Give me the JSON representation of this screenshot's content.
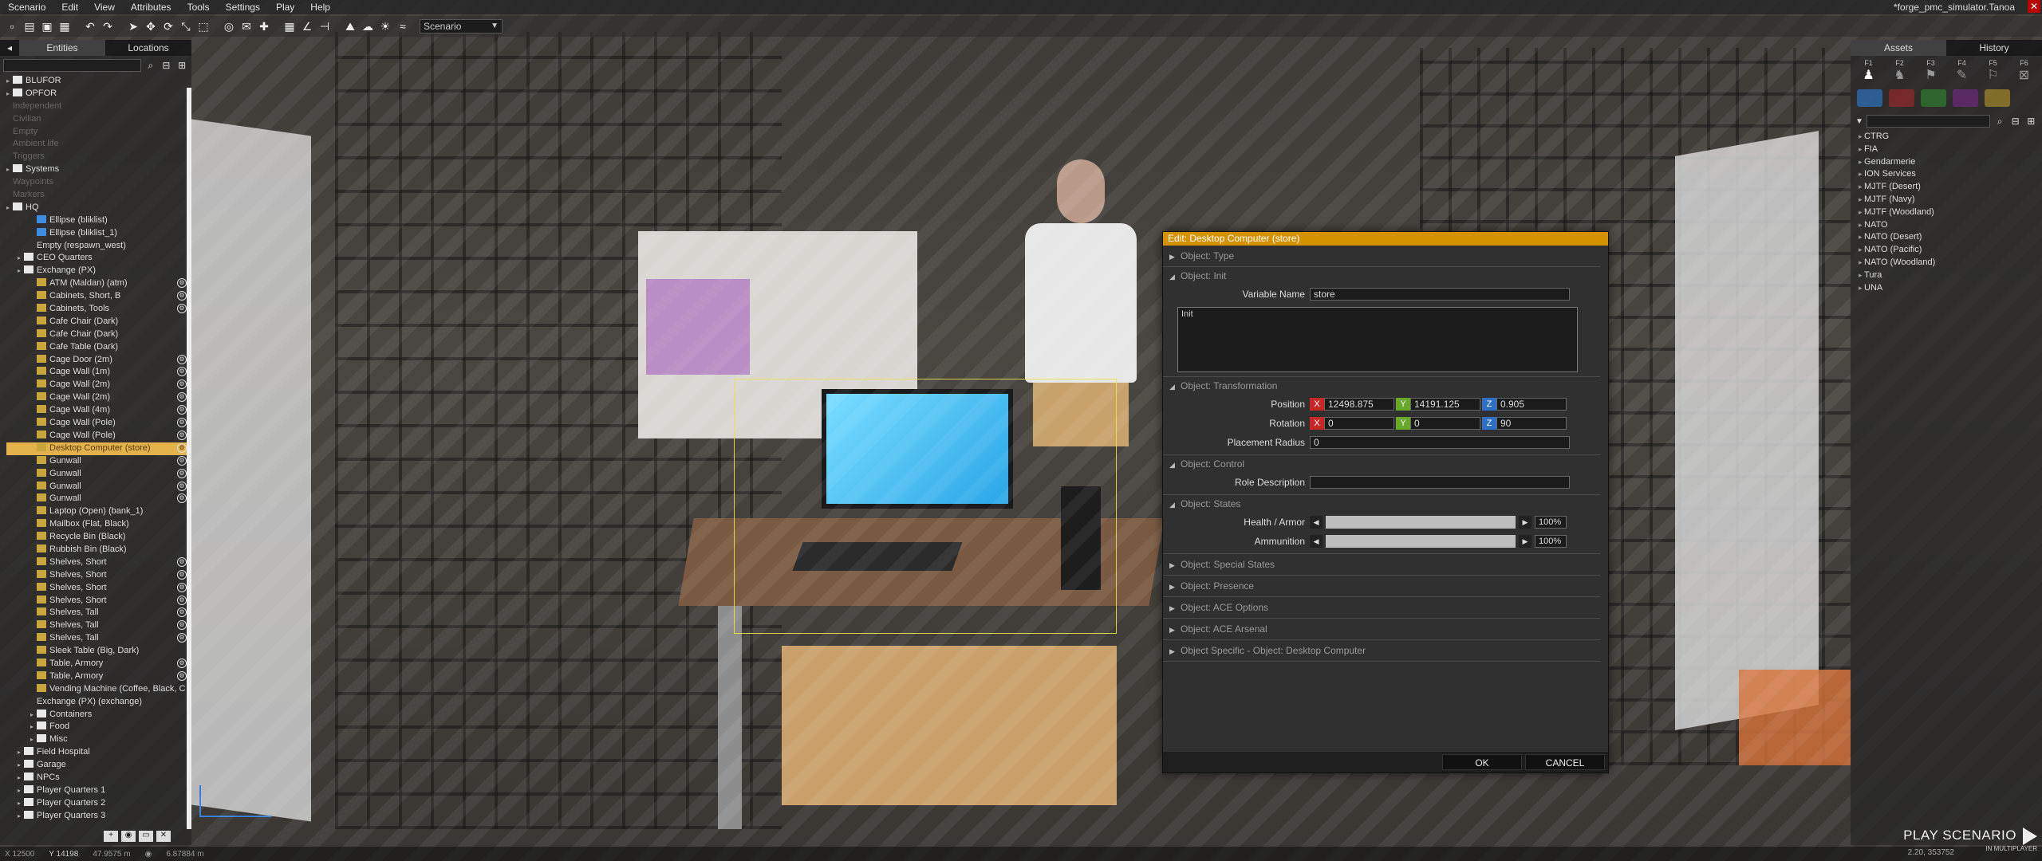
{
  "menu": {
    "items": [
      "Scenario",
      "Edit",
      "View",
      "Attributes",
      "Tools",
      "Settings",
      "Play",
      "Help"
    ],
    "window_title": "*forge_pmc_simulator.Tanoa"
  },
  "toolbar": {
    "mode": "Scenario"
  },
  "left_panel": {
    "tabs": [
      "Entities",
      "Locations"
    ],
    "tree": [
      {
        "label": "BLUFOR",
        "indent": 0,
        "icon": "checkbox",
        "state": "normal"
      },
      {
        "label": "OPFOR",
        "indent": 0,
        "icon": "checkbox",
        "state": "normal"
      },
      {
        "label": "Independent",
        "indent": 0,
        "icon": "none",
        "state": "dim"
      },
      {
        "label": "Civilian",
        "indent": 0,
        "icon": "none",
        "state": "dim"
      },
      {
        "label": "Empty",
        "indent": 0,
        "icon": "none",
        "state": "dim"
      },
      {
        "label": "Ambient life",
        "indent": 0,
        "icon": "none",
        "state": "dim"
      },
      {
        "label": "Triggers",
        "indent": 0,
        "icon": "none",
        "state": "dim"
      },
      {
        "label": "Systems",
        "indent": 0,
        "icon": "checkbox",
        "state": "normal"
      },
      {
        "label": "Waypoints",
        "indent": 0,
        "icon": "none",
        "state": "dim"
      },
      {
        "label": "Markers",
        "indent": 0,
        "icon": "none",
        "state": "dim"
      },
      {
        "label": "HQ",
        "indent": 0,
        "icon": "checkbox",
        "state": "normal"
      },
      {
        "label": "Ellipse (bliklist)",
        "indent": 2,
        "icon": "marker",
        "state": "normal"
      },
      {
        "label": "Ellipse (bliklist_1)",
        "indent": 2,
        "icon": "marker",
        "state": "normal"
      },
      {
        "label": "Empty (respawn_west)",
        "indent": 2,
        "icon": "none",
        "state": "normal"
      },
      {
        "label": "CEO Quarters",
        "indent": 1,
        "icon": "folder",
        "state": "normal"
      },
      {
        "label": "Exchange (PX)",
        "indent": 1,
        "icon": "folder",
        "state": "normal"
      },
      {
        "label": "ATM (Maldan) (atm)",
        "indent": 2,
        "icon": "obj",
        "state": "normal",
        "badge": true
      },
      {
        "label": "Cabinets, Short, B",
        "indent": 2,
        "icon": "obj",
        "state": "normal",
        "badge": true
      },
      {
        "label": "Cabinets, Tools",
        "indent": 2,
        "icon": "obj",
        "state": "normal",
        "badge": true
      },
      {
        "label": "Cafe Chair (Dark)",
        "indent": 2,
        "icon": "obj",
        "state": "normal"
      },
      {
        "label": "Cafe Chair (Dark)",
        "indent": 2,
        "icon": "obj",
        "state": "normal"
      },
      {
        "label": "Cafe Table (Dark)",
        "indent": 2,
        "icon": "obj",
        "state": "normal"
      },
      {
        "label": "Cage Door (2m)",
        "indent": 2,
        "icon": "obj",
        "state": "normal",
        "badge": true
      },
      {
        "label": "Cage Wall (1m)",
        "indent": 2,
        "icon": "obj",
        "state": "normal",
        "badge": true
      },
      {
        "label": "Cage Wall (2m)",
        "indent": 2,
        "icon": "obj",
        "state": "normal",
        "badge": true
      },
      {
        "label": "Cage Wall (2m)",
        "indent": 2,
        "icon": "obj",
        "state": "normal",
        "badge": true
      },
      {
        "label": "Cage Wall (4m)",
        "indent": 2,
        "icon": "obj",
        "state": "normal",
        "badge": true
      },
      {
        "label": "Cage Wall (Pole)",
        "indent": 2,
        "icon": "obj",
        "state": "normal",
        "badge": true
      },
      {
        "label": "Cage Wall (Pole)",
        "indent": 2,
        "icon": "obj",
        "state": "normal",
        "badge": true
      },
      {
        "label": "Desktop Computer (store)",
        "indent": 2,
        "icon": "obj",
        "state": "selected",
        "badge": true
      },
      {
        "label": "Gunwall",
        "indent": 2,
        "icon": "obj",
        "state": "normal",
        "badge": true
      },
      {
        "label": "Gunwall",
        "indent": 2,
        "icon": "obj",
        "state": "normal",
        "badge": true
      },
      {
        "label": "Gunwall",
        "indent": 2,
        "icon": "obj",
        "state": "normal",
        "badge": true
      },
      {
        "label": "Gunwall",
        "indent": 2,
        "icon": "obj",
        "state": "normal",
        "badge": true
      },
      {
        "label": "Laptop (Open) (bank_1)",
        "indent": 2,
        "icon": "obj",
        "state": "normal"
      },
      {
        "label": "Mailbox (Flat, Black)",
        "indent": 2,
        "icon": "obj",
        "state": "normal"
      },
      {
        "label": "Recycle Bin (Black)",
        "indent": 2,
        "icon": "obj",
        "state": "normal"
      },
      {
        "label": "Rubbish Bin (Black)",
        "indent": 2,
        "icon": "obj",
        "state": "normal"
      },
      {
        "label": "Shelves, Short",
        "indent": 2,
        "icon": "obj",
        "state": "normal",
        "badge": true
      },
      {
        "label": "Shelves, Short",
        "indent": 2,
        "icon": "obj",
        "state": "normal",
        "badge": true
      },
      {
        "label": "Shelves, Short",
        "indent": 2,
        "icon": "obj",
        "state": "normal",
        "badge": true
      },
      {
        "label": "Shelves, Short",
        "indent": 2,
        "icon": "obj",
        "state": "normal",
        "badge": true
      },
      {
        "label": "Shelves, Tall",
        "indent": 2,
        "icon": "obj",
        "state": "normal",
        "badge": true
      },
      {
        "label": "Shelves, Tall",
        "indent": 2,
        "icon": "obj",
        "state": "normal",
        "badge": true
      },
      {
        "label": "Shelves, Tall",
        "indent": 2,
        "icon": "obj",
        "state": "normal",
        "badge": true
      },
      {
        "label": "Sleek Table (Big, Dark)",
        "indent": 2,
        "icon": "obj",
        "state": "normal"
      },
      {
        "label": "Table, Armory",
        "indent": 2,
        "icon": "obj",
        "state": "normal",
        "badge": true
      },
      {
        "label": "Table, Armory",
        "indent": 2,
        "icon": "obj",
        "state": "normal",
        "badge": true
      },
      {
        "label": "Vending Machine (Coffee, Black, C",
        "indent": 2,
        "icon": "obj",
        "state": "normal"
      },
      {
        "label": "Exchange (PX) (exchange)",
        "indent": 2,
        "icon": "none",
        "state": "normal"
      },
      {
        "label": "Containers",
        "indent": 2,
        "icon": "folder",
        "state": "normal"
      },
      {
        "label": "Food",
        "indent": 2,
        "icon": "folder",
        "state": "normal"
      },
      {
        "label": "Misc",
        "indent": 2,
        "icon": "folder",
        "state": "normal"
      },
      {
        "label": "Field Hospital",
        "indent": 1,
        "icon": "folder",
        "state": "normal"
      },
      {
        "label": "Garage",
        "indent": 1,
        "icon": "folder",
        "state": "normal"
      },
      {
        "label": "NPCs",
        "indent": 1,
        "icon": "folder",
        "state": "normal"
      },
      {
        "label": "Player Quarters 1",
        "indent": 1,
        "icon": "folder",
        "state": "normal"
      },
      {
        "label": "Player Quarters 2",
        "indent": 1,
        "icon": "folder",
        "state": "normal"
      },
      {
        "label": "Player Quarters 3",
        "indent": 1,
        "icon": "folder",
        "state": "normal"
      }
    ]
  },
  "right_panel": {
    "tabs": [
      "Assets",
      "History"
    ],
    "fkeys": [
      "F1",
      "F2",
      "F3",
      "F4",
      "F5",
      "F6"
    ],
    "factions": [
      "CTRG",
      "FIA",
      "Gendarmerie",
      "ION Services",
      "MJTF (Desert)",
      "MJTF (Navy)",
      "MJTF (Woodland)",
      "NATO",
      "NATO (Desert)",
      "NATO (Pacific)",
      "NATO (Woodland)",
      "Tura",
      "UNA"
    ]
  },
  "dialog": {
    "title": "Edit: Desktop Computer (store)",
    "sections": {
      "type": "Object: Type",
      "init": "Object: Init",
      "transformation": "Object: Transformation",
      "control": "Object: Control",
      "states": "Object: States",
      "special_states": "Object: Special States",
      "presence": "Object: Presence",
      "ace_options": "Object: ACE Options",
      "ace_arsenal": "Object: ACE Arsenal",
      "specific": "Object Specific - Object: Desktop Computer"
    },
    "variable_name_label": "Variable Name",
    "variable_name": "store",
    "init_label": "Init",
    "position_label": "Position",
    "position": {
      "x": "12498.875",
      "y": "14191.125",
      "z": "0.905"
    },
    "rotation_label": "Rotation",
    "rotation": {
      "x": "0",
      "y": "0",
      "z": "90"
    },
    "placement_radius_label": "Placement Radius",
    "placement_radius": "0",
    "role_description_label": "Role Description",
    "role_description": "",
    "health_label": "Health / Armor",
    "health": "100%",
    "health_fraction": 1.0,
    "ammo_label": "Ammunition",
    "ammo": "100%",
    "ammo_fraction": 1.0,
    "axis": {
      "x": "X",
      "y": "Y",
      "z": "Z"
    },
    "ok": "OK",
    "cancel": "CANCEL"
  },
  "play": {
    "label": "PLAY SCENARIO",
    "sub": "IN MULTIPLAYER"
  },
  "status": {
    "a": "X 12500",
    "b": "Y 14198",
    "c": "47.9575 m",
    "d": "6.87884 m",
    "coord": "2.20, 353752"
  }
}
